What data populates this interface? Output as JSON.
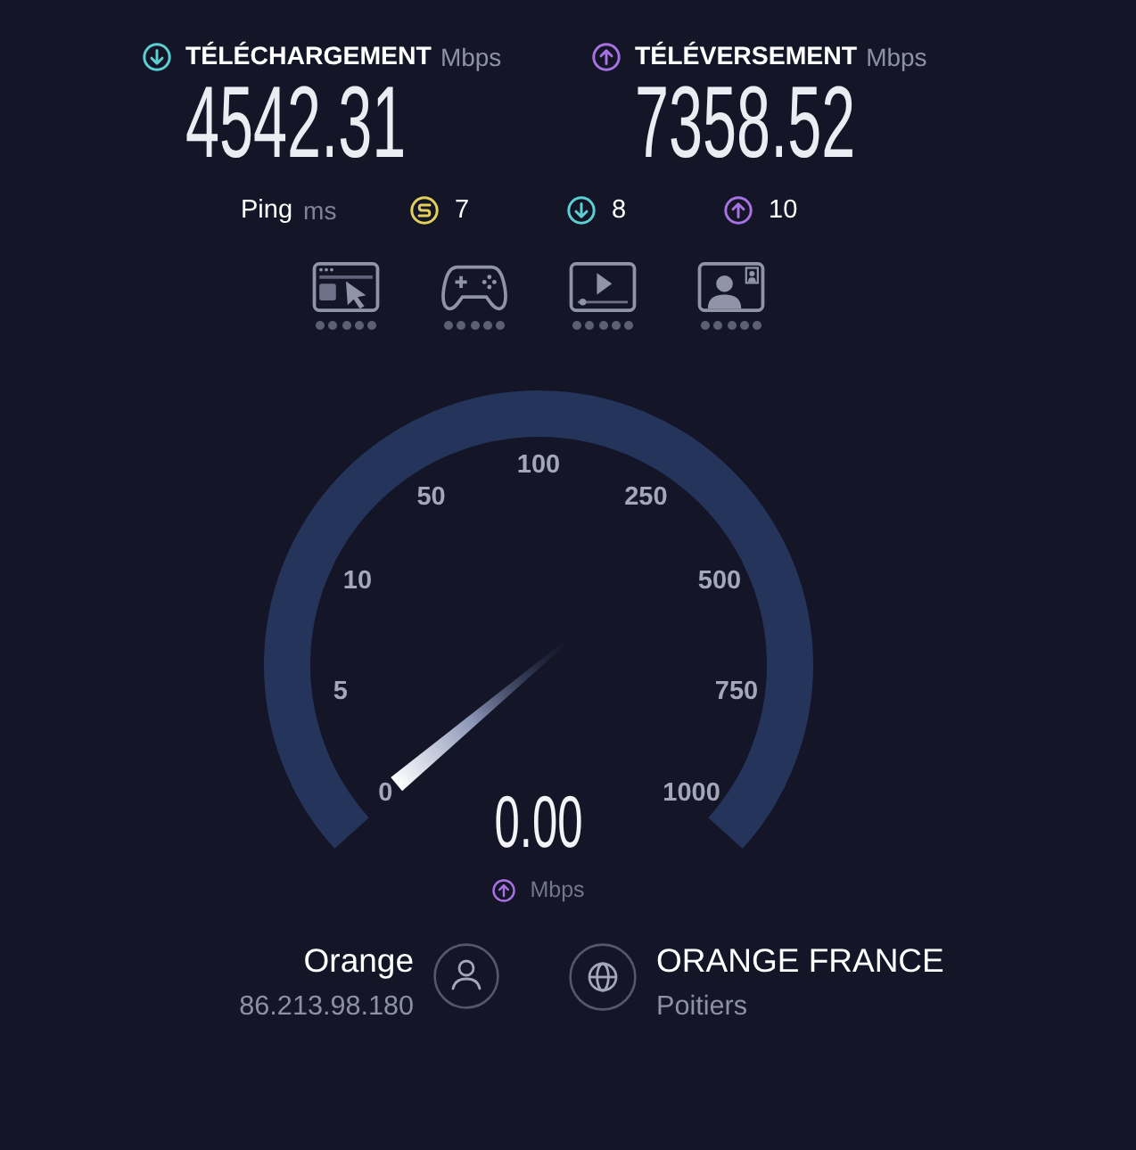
{
  "results": [
    {
      "kind": "download",
      "label": "TÉLÉCHARGEMENT",
      "unit": "Mbps",
      "value": "4542.31"
    },
    {
      "kind": "upload",
      "label": "TÉLÉVERSEMENT",
      "unit": "Mbps",
      "value": "7358.52"
    }
  ],
  "ping": {
    "label": "Ping",
    "unit": "ms",
    "readings": [
      {
        "kind": "idle",
        "value": "7"
      },
      {
        "kind": "download",
        "value": "8"
      },
      {
        "kind": "upload",
        "value": "10"
      }
    ]
  },
  "use_cases": [
    {
      "kind": "browsing",
      "stars": 0
    },
    {
      "kind": "gaming",
      "stars": 0
    },
    {
      "kind": "streaming",
      "stars": 0
    },
    {
      "kind": "videocall",
      "stars": 0
    }
  ],
  "gauge": {
    "kind": "upload",
    "ticks": [
      "0",
      "5",
      "10",
      "50",
      "100",
      "250",
      "500",
      "750",
      "1000"
    ],
    "value": "0.00",
    "unit": "Mbps"
  },
  "client": {
    "name": "Orange",
    "ip": "86.213.98.180"
  },
  "server": {
    "name": "ORANGE FRANCE",
    "location": "Poitiers"
  }
}
